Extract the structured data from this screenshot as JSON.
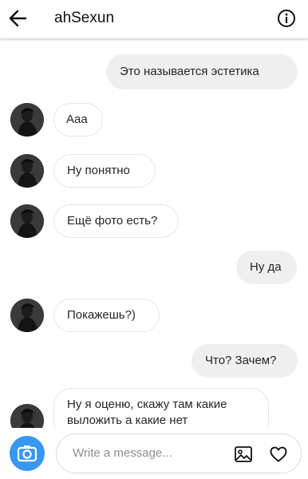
{
  "header": {
    "title": "ahSexun",
    "back_icon": "arrow-left-icon",
    "info_icon": "info-circle-icon"
  },
  "messages": [
    {
      "direction": "out",
      "text": "Это называется эстетика"
    },
    {
      "direction": "in",
      "text": "Aaa"
    },
    {
      "direction": "in",
      "text": "Ну понятно"
    },
    {
      "direction": "in",
      "text": "Ещё фото есть?"
    },
    {
      "direction": "out",
      "text": "Ну да"
    },
    {
      "direction": "in",
      "text": "Покажешь?)"
    },
    {
      "direction": "out",
      "text": "Что? Зачем?"
    },
    {
      "direction": "in",
      "text": "Ну я оценю, скажу там какие",
      "text2": "выложить а какие нет"
    }
  ],
  "composer": {
    "placeholder": "Write a message...",
    "camera_icon": "camera-icon",
    "gallery_icon": "image-icon",
    "like_icon": "heart-icon"
  },
  "colors": {
    "accent": "#3897f0",
    "outgoing_bubble": "#efefef",
    "incoming_border": "#e6e6e6"
  }
}
